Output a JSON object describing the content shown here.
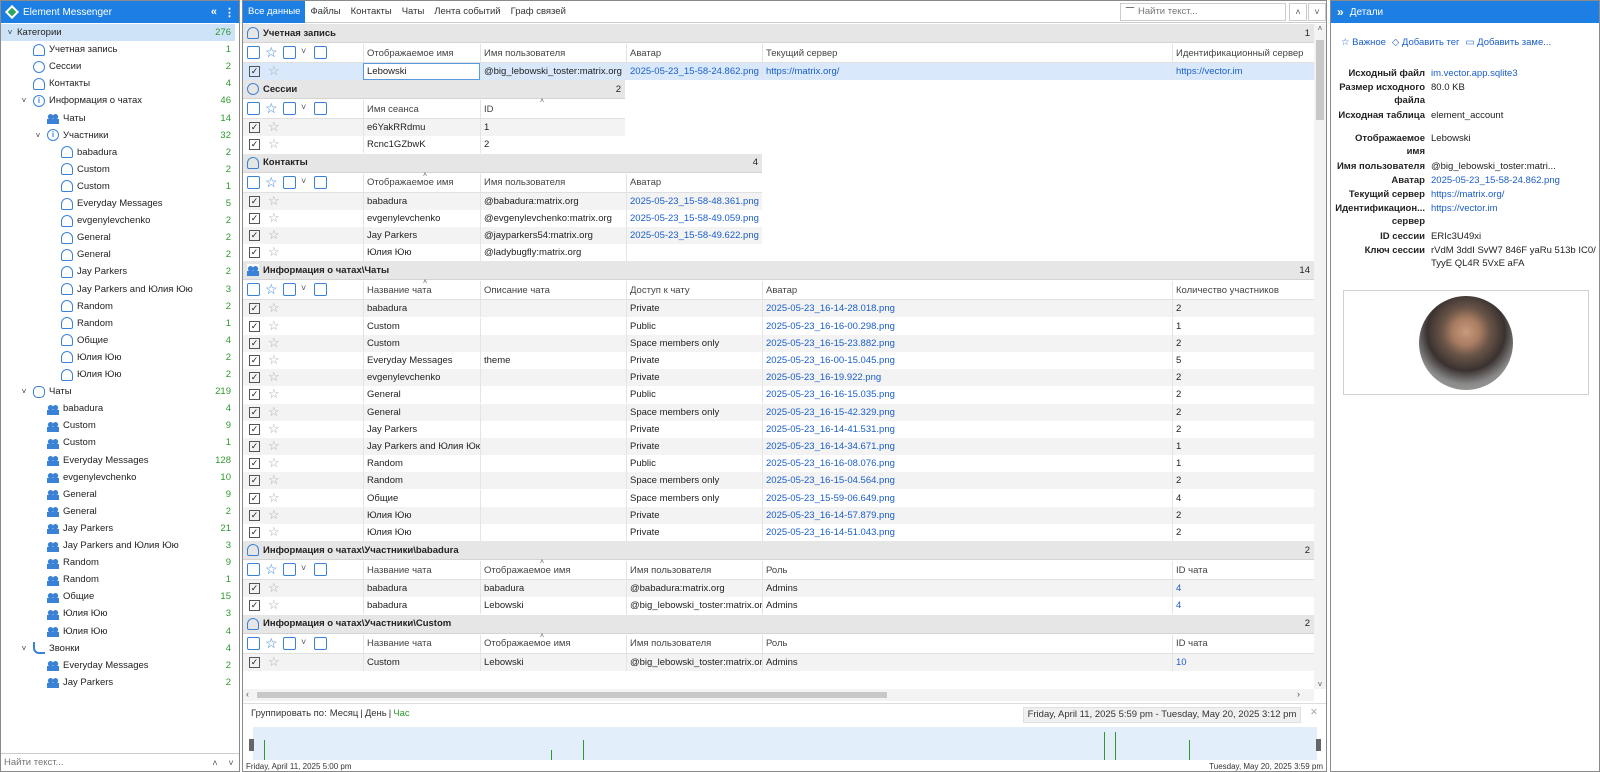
{
  "app": {
    "title": "Element Messenger"
  },
  "tree": {
    "items": [
      {
        "label": "Категории",
        "count": "276",
        "level": 0,
        "icon": "none",
        "exp": "v",
        "sel": true
      },
      {
        "label": "Учетная запись",
        "count": "1",
        "level": 1,
        "icon": "user"
      },
      {
        "label": "Сессии",
        "count": "2",
        "level": 1,
        "icon": "clock"
      },
      {
        "label": "Контакты",
        "count": "4",
        "level": 1,
        "icon": "user"
      },
      {
        "label": "Информация о чатах",
        "count": "46",
        "level": 1,
        "icon": "info",
        "exp": "v"
      },
      {
        "label": "Чаты",
        "count": "14",
        "level": 2,
        "icon": "group"
      },
      {
        "label": "Участники",
        "count": "32",
        "level": 2,
        "icon": "info",
        "exp": "v"
      },
      {
        "label": "babadura",
        "count": "2",
        "level": 3,
        "icon": "user"
      },
      {
        "label": "Custom",
        "count": "2",
        "level": 3,
        "icon": "user"
      },
      {
        "label": "Custom",
        "count": "1",
        "level": 3,
        "icon": "user"
      },
      {
        "label": "Everyday Messages",
        "count": "5",
        "level": 3,
        "icon": "user"
      },
      {
        "label": "evgenylevchenko",
        "count": "2",
        "level": 3,
        "icon": "user"
      },
      {
        "label": "General",
        "count": "2",
        "level": 3,
        "icon": "user"
      },
      {
        "label": "General",
        "count": "2",
        "level": 3,
        "icon": "user"
      },
      {
        "label": "Jay Parkers",
        "count": "2",
        "level": 3,
        "icon": "user"
      },
      {
        "label": "Jay Parkers and Юлия Юю",
        "count": "3",
        "level": 3,
        "icon": "user"
      },
      {
        "label": "Random",
        "count": "2",
        "level": 3,
        "icon": "user"
      },
      {
        "label": "Random",
        "count": "1",
        "level": 3,
        "icon": "user"
      },
      {
        "label": "Общие",
        "count": "4",
        "level": 3,
        "icon": "user"
      },
      {
        "label": "Юлия Юю",
        "count": "2",
        "level": 3,
        "icon": "user"
      },
      {
        "label": "Юлия Юю",
        "count": "2",
        "level": 3,
        "icon": "user"
      },
      {
        "label": "Чаты",
        "count": "219",
        "level": 1,
        "icon": "chat",
        "exp": "v"
      },
      {
        "label": "babadura",
        "count": "4",
        "level": 2,
        "icon": "group"
      },
      {
        "label": "Custom",
        "count": "9",
        "level": 2,
        "icon": "group"
      },
      {
        "label": "Custom",
        "count": "1",
        "level": 2,
        "icon": "group"
      },
      {
        "label": "Everyday Messages",
        "count": "128",
        "level": 2,
        "icon": "group"
      },
      {
        "label": "evgenylevchenko",
        "count": "10",
        "level": 2,
        "icon": "group"
      },
      {
        "label": "General",
        "count": "9",
        "level": 2,
        "icon": "group"
      },
      {
        "label": "General",
        "count": "2",
        "level": 2,
        "icon": "group"
      },
      {
        "label": "Jay Parkers",
        "count": "21",
        "level": 2,
        "icon": "group"
      },
      {
        "label": "Jay Parkers and Юлия Юю",
        "count": "3",
        "level": 2,
        "icon": "group"
      },
      {
        "label": "Random",
        "count": "9",
        "level": 2,
        "icon": "group"
      },
      {
        "label": "Random",
        "count": "1",
        "level": 2,
        "icon": "group"
      },
      {
        "label": "Общие",
        "count": "15",
        "level": 2,
        "icon": "group"
      },
      {
        "label": "Юлия Юю",
        "count": "3",
        "level": 2,
        "icon": "group"
      },
      {
        "label": "Юлия Юю",
        "count": "4",
        "level": 2,
        "icon": "group"
      },
      {
        "label": "Звонки",
        "count": "4",
        "level": 1,
        "icon": "phone",
        "exp": "v"
      },
      {
        "label": "Everyday Messages",
        "count": "2",
        "level": 2,
        "icon": "group"
      },
      {
        "label": "Jay Parkers",
        "count": "2",
        "level": 2,
        "icon": "group"
      }
    ],
    "search_placeholder": "Найти текст..."
  },
  "tabs": [
    "Все данные",
    "Файлы",
    "Контакты",
    "Чаты",
    "Лента событий",
    "Граф связей"
  ],
  "center_search_placeholder": "Найти текст...",
  "sections": [
    {
      "title": "Учетная запись",
      "count": "1",
      "icon": "user",
      "cols": [
        "Отображаемое имя",
        "Имя пользователя",
        "Аватар",
        "Текущий сервер",
        "Идентификационный сервер"
      ],
      "rows": [
        [
          "Lebowski",
          "@big_lebowski_toster:matrix.org",
          "2025-05-23_15-58-24.862.png",
          "https://matrix.org/",
          "https://vector.im"
        ]
      ],
      "links": [
        2,
        3,
        4
      ]
    },
    {
      "title": "Сессии",
      "count": "2",
      "icon": "clock",
      "cols": [
        "Имя сеанса",
        "ID"
      ],
      "rows": [
        [
          "e6YakRRdmu",
          "1"
        ],
        [
          "Rcnc1GZbwK",
          "2"
        ]
      ],
      "links": []
    },
    {
      "title": "Контакты",
      "count": "4",
      "icon": "user",
      "cols": [
        "Отображаемое имя",
        "Имя пользователя",
        "Аватар"
      ],
      "rows": [
        [
          "babadura",
          "@babadura:matrix.org",
          "2025-05-23_15-58-48.361.png"
        ],
        [
          "evgenylevchenko",
          "@evgenylevchenko:matrix.org",
          "2025-05-23_15-58-49.059.png"
        ],
        [
          "Jay Parkers",
          "@jayparkers54:matrix.org",
          "2025-05-23_15-58-49.622.png"
        ],
        [
          "Юлия Юю",
          "@ladybugfly:matrix.org",
          ""
        ]
      ],
      "links": [
        2
      ]
    },
    {
      "title": "Информация о чатах\\Чаты",
      "count": "14",
      "icon": "group",
      "cols": [
        "Название чата",
        "Описание чата",
        "Доступ к чату",
        "Аватар",
        "Количество участников"
      ],
      "rows": [
        [
          "babadura",
          "",
          "Private",
          "2025-05-23_16-14-28.018.png",
          "2"
        ],
        [
          "Custom",
          "",
          "Public",
          "2025-05-23_16-16-00.298.png",
          "1"
        ],
        [
          "Custom",
          "",
          "Space members only",
          "2025-05-23_16-15-23.882.png",
          "2"
        ],
        [
          "Everyday Messages",
          "theme",
          "Private",
          "2025-05-23_16-00-15.045.png",
          "5"
        ],
        [
          "evgenylevchenko",
          "",
          "Private",
          "2025-05-23_16-19.922.png",
          "2"
        ],
        [
          "General",
          "",
          "Public",
          "2025-05-23_16-16-15.035.png",
          "2"
        ],
        [
          "General",
          "",
          "Space members only",
          "2025-05-23_16-15-42.329.png",
          "2"
        ],
        [
          "Jay Parkers",
          "",
          "Private",
          "2025-05-23_16-14-41.531.png",
          "2"
        ],
        [
          "Jay Parkers and Юлия Юю",
          "",
          "Private",
          "2025-05-23_16-14-34.671.png",
          "1"
        ],
        [
          "Random",
          "",
          "Public",
          "2025-05-23_16-16-08.076.png",
          "1"
        ],
        [
          "Random",
          "",
          "Space members only",
          "2025-05-23_16-15-04.564.png",
          "2"
        ],
        [
          "Общие",
          "",
          "Space members only",
          "2025-05-23_15-59-06.649.png",
          "4"
        ],
        [
          "Юлия Юю",
          "",
          "Private",
          "2025-05-23_16-14-57.879.png",
          "2"
        ],
        [
          "Юлия Юю",
          "",
          "Private",
          "2025-05-23_16-14-51.043.png",
          "2"
        ]
      ],
      "links": [
        3
      ]
    },
    {
      "title": "Информация о чатах\\Участники\\babadura",
      "count": "2",
      "icon": "user",
      "cols": [
        "Название чата",
        "Отображаемое имя",
        "Имя пользователя",
        "Роль",
        "ID чата"
      ],
      "rows": [
        [
          "babadura",
          "babadura",
          "@babadura:matrix.org",
          "Admins",
          "4"
        ],
        [
          "babadura",
          "Lebowski",
          "@big_lebowski_toster:matrix.org",
          "Admins",
          "4"
        ]
      ],
      "links": [
        4
      ]
    },
    {
      "title": "Информация о чатах\\Участники\\Custom",
      "count": "2",
      "icon": "user",
      "cols": [
        "Название чата",
        "Отображаемое имя",
        "Имя пользователя",
        "Роль",
        "ID чата"
      ],
      "rows": [
        [
          "Custom",
          "Lebowski",
          "@big_lebowski_toster:matrix.org",
          "Admins",
          "10"
        ]
      ],
      "links": [
        4
      ]
    }
  ],
  "timeline": {
    "group_by_label": "Группировать по:",
    "options": [
      "Месяц",
      "День",
      "Час"
    ],
    "active": "Час",
    "range": "Friday, April 11, 2025 5:59 pm - Tuesday, May 20, 2025 3:12 pm",
    "start": "Friday, April 11, 2025 5:00 pm",
    "end": "Tuesday, May 20, 2025 3:59 pm",
    "bar_positions": [
      0.01,
      0.28,
      0.31,
      0.8,
      0.81,
      0.88
    ]
  },
  "details": {
    "title": "Детали",
    "actions": [
      "Важное",
      "Добавить тег",
      "Добавить заме..."
    ],
    "props": [
      {
        "k": "Исходный файл",
        "v": "im.vector.app.sqlite3",
        "link": true
      },
      {
        "k": "Размер исходного файла",
        "v": "80.0 KB"
      },
      {
        "k": "Исходная таблица",
        "v": "element_account"
      },
      {
        "k": "Отображаемое имя",
        "v": "Lebowski"
      },
      {
        "k": "Имя пользователя",
        "v": "@big_lebowski_toster:matri..."
      },
      {
        "k": "Аватар",
        "v": "2025-05-23_15-58-24.862.png",
        "link": true
      },
      {
        "k": "Текущий сервер",
        "v": "https://matrix.org/",
        "link": true
      },
      {
        "k": "Идентификацион... сервер",
        "v": "https://vector.im",
        "link": true
      },
      {
        "k": "ID сессии",
        "v": "ERIc3U49xi"
      },
      {
        "k": "Ключ сессии",
        "v": "rVdM 3ddI SvW7 846F yaRu 513b IC0/ TyyE QL4R 5VxE aFA"
      }
    ]
  }
}
